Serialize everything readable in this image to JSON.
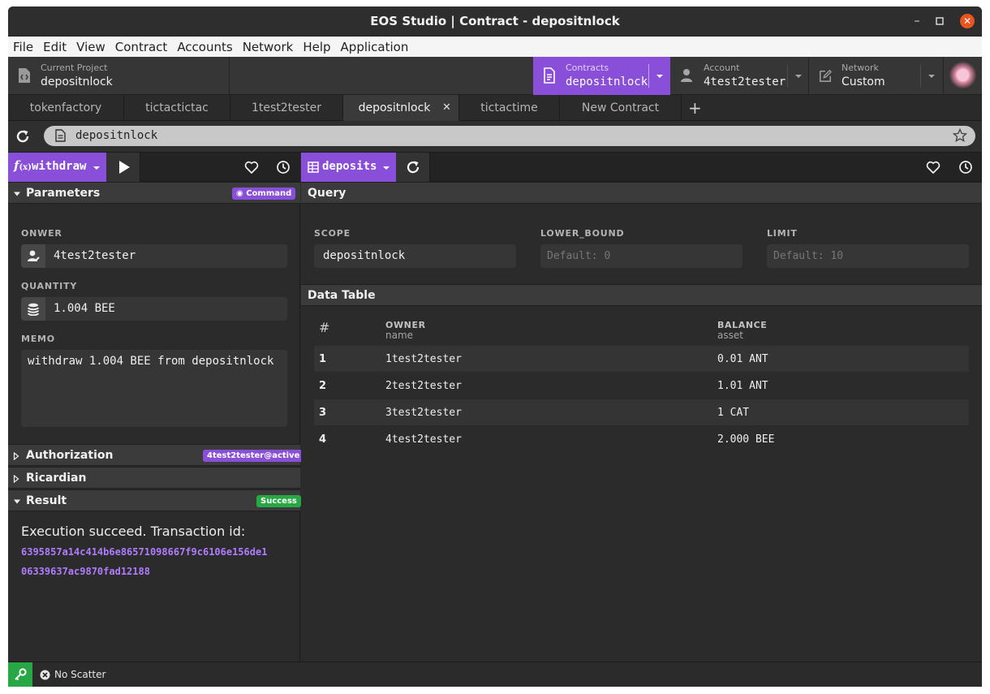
{
  "window": {
    "title": "EOS Studio | Contract - depositnlock"
  },
  "menu": [
    "File",
    "Edit",
    "View",
    "Contract",
    "Accounts",
    "Network",
    "Help",
    "Application"
  ],
  "header": {
    "project_label": "Current Project",
    "project_value": "depositnlock",
    "contracts_label": "Contracts",
    "contracts_value": "depositnlock",
    "account_label": "Account",
    "account_value": "4test2tester",
    "network_label": "Network",
    "network_value": "Custom"
  },
  "tabs": [
    {
      "label": "tokenfactory"
    },
    {
      "label": "tictactictac"
    },
    {
      "label": "1test2tester"
    },
    {
      "label": "depositnlock",
      "active": true
    },
    {
      "label": "tictactime"
    },
    {
      "label": "New Contract"
    }
  ],
  "address": {
    "value": "depositnlock"
  },
  "action_panel": {
    "action_name": "withdraw",
    "parameters_title": "Parameters",
    "command_badge": "Command",
    "fields": [
      {
        "label": "ONWER",
        "value": "4test2tester"
      },
      {
        "label": "QUANTITY",
        "value": "1.004 BEE"
      },
      {
        "label": "MEMO",
        "value": "withdraw 1.004 BEE from depositnlock"
      }
    ],
    "authorization_title": "Authorization",
    "authorization_badge": "4test2tester@active",
    "ricardian_title": "Ricardian",
    "result_title": "Result",
    "result_badge": "Success",
    "result_message": "Execution succeed. Transaction id:",
    "transaction_id_line1": "6395857a14c414b6e86571098667f9c6106e156de1",
    "transaction_id_line2": "06339637ac9870fad12188"
  },
  "table_panel": {
    "table_name": "deposits",
    "query_title": "Query",
    "query_fields": [
      {
        "label": "SCOPE",
        "value": "depositnlock",
        "placeholder": ""
      },
      {
        "label": "LOWER_BOUND",
        "value": "",
        "placeholder": "Default: 0"
      },
      {
        "label": "LIMIT",
        "value": "",
        "placeholder": "Default: 10"
      }
    ],
    "data_table_title": "Data Table",
    "columns": [
      {
        "name": "#",
        "type": ""
      },
      {
        "name": "OWNER",
        "type": "name"
      },
      {
        "name": "BALANCE",
        "type": "asset"
      }
    ],
    "rows": [
      {
        "index": "1",
        "owner": "1test2tester",
        "balance": "0.01 ANT"
      },
      {
        "index": "2",
        "owner": "2test2tester",
        "balance": "1.01 ANT"
      },
      {
        "index": "3",
        "owner": "3test2tester",
        "balance": "1 CAT"
      },
      {
        "index": "4",
        "owner": "4test2tester",
        "balance": "2.000 BEE"
      }
    ]
  },
  "status_bar": {
    "scatter": "No Scatter"
  },
  "colors": {
    "accent": "#8a4fd8",
    "success": "#28a745",
    "txid": "#b07cff"
  }
}
